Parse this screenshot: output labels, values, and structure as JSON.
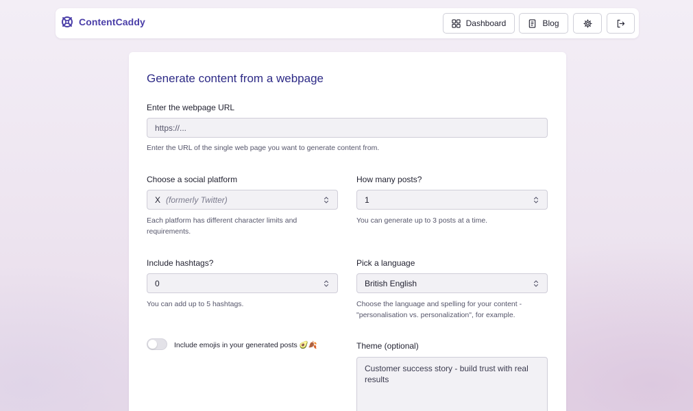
{
  "app": {
    "name": "ContentCaddy"
  },
  "nav": {
    "dashboard_label": "Dashboard",
    "blog_label": "Blog",
    "settings_icon": "gear-icon",
    "logout_icon": "logout-icon"
  },
  "form": {
    "title": "Generate content from a webpage",
    "url": {
      "label": "Enter the webpage URL",
      "placeholder": "https://...",
      "help": "Enter the URL of the single web page you want to generate content from."
    },
    "platform": {
      "label": "Choose a social platform",
      "value": "X",
      "value_note": "(formerly Twitter)",
      "help": "Each platform has different character limits and requirements."
    },
    "posts": {
      "label": "How many posts?",
      "value": "1",
      "help": "You can generate up to 3 posts at a time."
    },
    "hashtags": {
      "label": "Include hashtags?",
      "value": "0",
      "help": "You can add up to 5 hashtags."
    },
    "language": {
      "label": "Pick a language",
      "value": "British English",
      "help": "Choose the language and spelling for your content - \"personalisation vs. personalization\", for example."
    },
    "emojis": {
      "label": "Include emojis in your generated posts 🥑🍂",
      "enabled": false
    },
    "theme": {
      "label": "Theme (optional)",
      "value": "Customer success story - build trust with real results"
    }
  },
  "colors": {
    "brand": "#4a3ea8",
    "title": "#2d2a86",
    "field_bg": "#f2f1f5"
  }
}
